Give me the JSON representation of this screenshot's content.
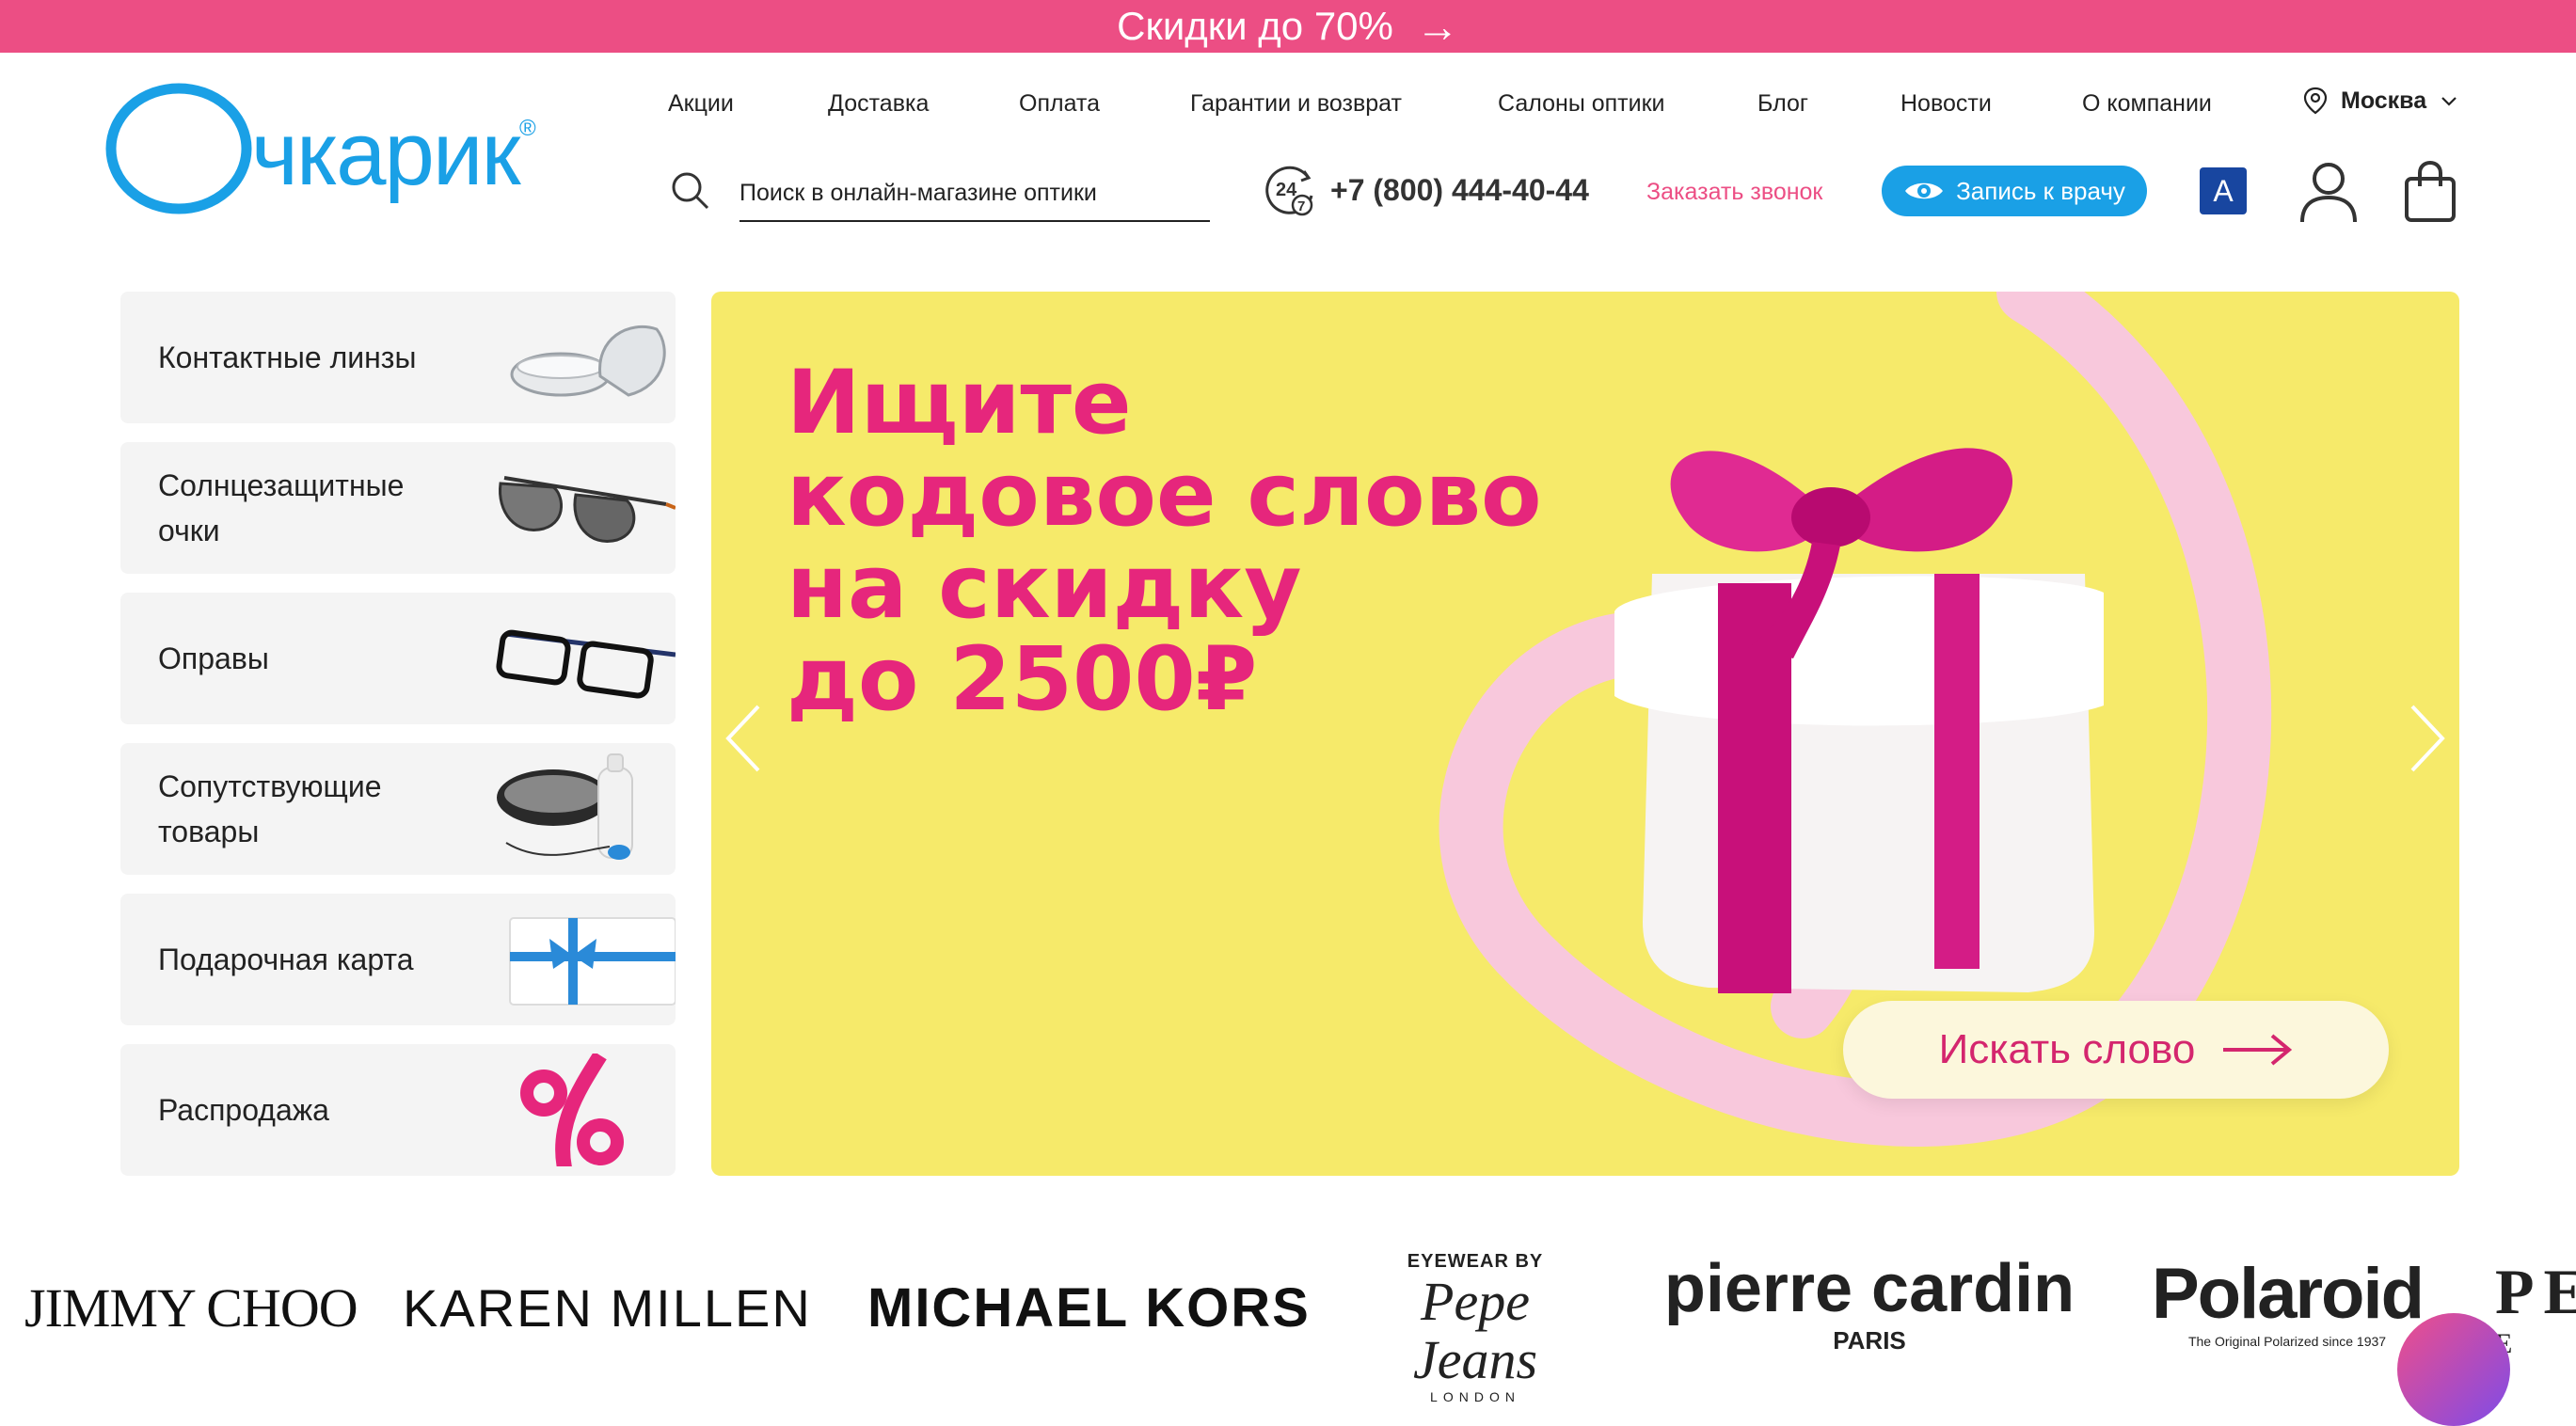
{
  "promo": {
    "text": "Скидки до 70%",
    "arrow": "→"
  },
  "logo": {
    "text": "Очкарик",
    "mark": "®",
    "color": "#1aa0e6"
  },
  "nav": {
    "items": [
      "Акции",
      "Доставка",
      "Оплата",
      "Гарантии и возврат",
      "Салоны оптики",
      "Блог",
      "Новости",
      "О компании"
    ]
  },
  "city": {
    "label": "Москва",
    "icon": "location-pin-icon"
  },
  "search": {
    "placeholder": "Поиск в онлайн-магазине оптики",
    "icon": "search-icon"
  },
  "contact": {
    "clock_badge": "24",
    "clock_sub": "7",
    "phone": "+7 (800) 444-40-44",
    "callback": "Заказать звонок"
  },
  "doctor_button": {
    "label": "Запись к врачу",
    "icon": "eye-icon"
  },
  "accessibility": {
    "label": "A"
  },
  "categories": [
    {
      "label": "Контактные линзы",
      "icon": "contact-lenses-image"
    },
    {
      "label": "Солнцезащитные очки",
      "icon": "sunglasses-image"
    },
    {
      "label": "Оправы",
      "icon": "frames-image"
    },
    {
      "label": "Сопутствующие товары",
      "icon": "accessories-image"
    },
    {
      "label": "Подарочная карта",
      "icon": "gift-card-image"
    },
    {
      "label": "Распродажа",
      "icon": "percent-image"
    }
  ],
  "banner": {
    "lines": [
      "Ищите",
      "кодовое слово",
      "на скидку",
      "до 2500₽"
    ],
    "button_label": "Искать слово",
    "title_color": "#e6267c",
    "background": "#f6ea6a"
  },
  "brands": [
    {
      "label": "JIMMY CHOO"
    },
    {
      "label": "KAREN MILLEN"
    },
    {
      "label": "MICHAEL KORS"
    },
    {
      "top": "EYEWEAR BY",
      "label": "Pepe Jeans",
      "sub": "LONDON"
    },
    {
      "label": "pierre cardin",
      "sub": "PARIS"
    },
    {
      "label": "Polaroid",
      "sub": "The Original Polarized since 1937"
    },
    {
      "label": "PE",
      "sub": "E"
    }
  ],
  "colors": {
    "accent": "#ec4e84",
    "brand_blue": "#1aa0e6",
    "access_blue": "#1846a0"
  }
}
